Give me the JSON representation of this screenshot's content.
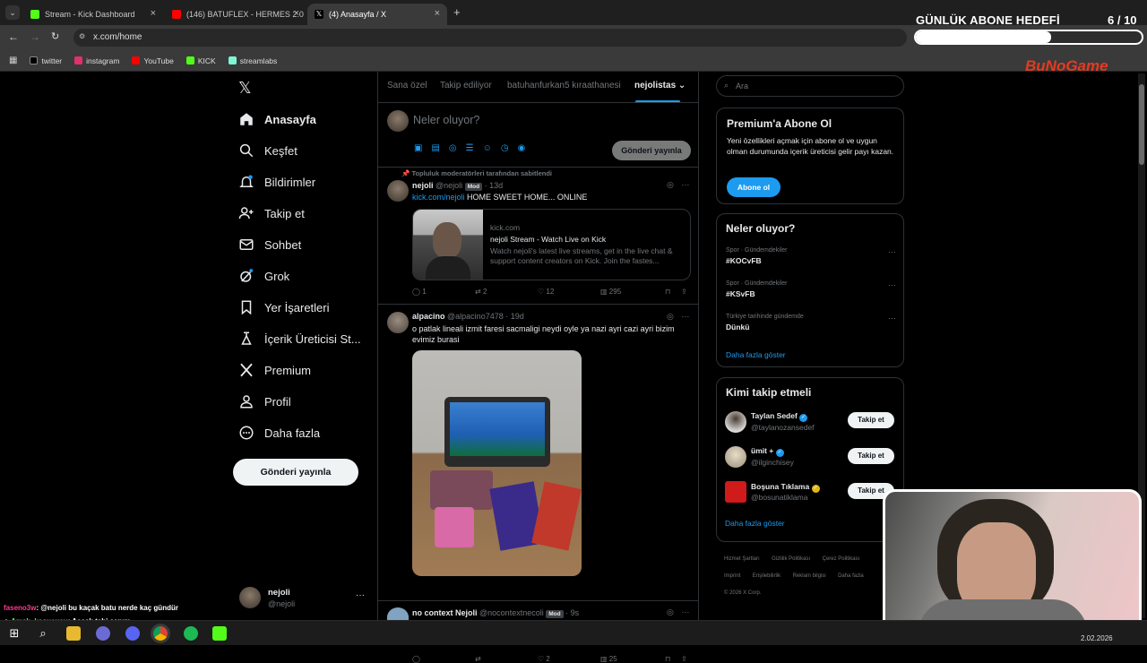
{
  "browser": {
    "tabs": [
      {
        "label": "Stream - Kick Dashboard",
        "color": "#53fc18"
      },
      {
        "label": "(146) BATUFLEX - HERMES 2.0 |",
        "color": "#ff0000"
      },
      {
        "label": "(4) Anasayfa / X",
        "color": "#ffffff"
      }
    ],
    "new_tab": "+",
    "address": "x.com/home",
    "bookmarks": [
      {
        "label": "twitter",
        "color": "#ffffff"
      },
      {
        "label": "instagram",
        "color": "#e1306c"
      },
      {
        "label": "YouTube",
        "color": "#ff0000"
      },
      {
        "label": "KICK",
        "color": "#53fc18"
      },
      {
        "label": "streamlabs",
        "color": "#80f5d2"
      }
    ]
  },
  "overlay": {
    "goal_title": "GÜNLÜK ABONE HEDEFİ",
    "goal_count": "6 / 10",
    "goal_progress": 0.6,
    "brand": "BuNoGame",
    "chat": [
      {
        "user": "faseno3w",
        "text": ": @nejoli bu kaçak batu nerde kaç gündür",
        "color": "#ff3b8d"
      },
      {
        "user": "Amck_kosucusu",
        "text": ": Açcak tabi canım",
        "color": "#53fc18"
      }
    ],
    "date": "2.02.2026"
  },
  "nav": {
    "items": [
      {
        "label": "Anasayfa",
        "icon": "home-icon"
      },
      {
        "label": "Keşfet",
        "icon": "search-icon"
      },
      {
        "label": "Bildirimler",
        "icon": "bell-icon"
      },
      {
        "label": "Takip et",
        "icon": "add-user-icon"
      },
      {
        "label": "Sohbet",
        "icon": "mail-icon"
      },
      {
        "label": "Grok",
        "icon": "grok-icon"
      },
      {
        "label": "Yer İşaretleri",
        "icon": "bookmark-icon"
      },
      {
        "label": "İçerik Üreticisi St...",
        "icon": "creator-icon"
      },
      {
        "label": "Premium",
        "icon": "x-logo-icon"
      },
      {
        "label": "Profil",
        "icon": "profile-icon"
      },
      {
        "label": "Daha fazla",
        "icon": "more-circle-icon"
      }
    ],
    "post_button": "Gönderi yayınla",
    "account": {
      "name": "nejoli",
      "handle": "@nejoli",
      "menu": "···"
    }
  },
  "feed": {
    "tabs": [
      "Sana özel",
      "Takip ediliyor",
      "batuhanfurkan5 kıraathanesi",
      "nejolistas"
    ],
    "active_tab": "nejolistas",
    "composer_placeholder": "Neler oluyor?",
    "composer_button": "Gönderi yayınla",
    "pinned_note": "Topluluk moderatörleri tarafından sabitlendi",
    "posts": [
      {
        "name": "nejoli",
        "handle": "@nejoli",
        "badge": "Mod",
        "time": "· 13d",
        "link_text": "kick.com/nejoli",
        "text": "HOME SWEET HOME... ONLINE",
        "card": {
          "domain": "kick.com",
          "title": "nejoli Stream - Watch Live on Kick",
          "desc": "Watch nejoli's latest live streams, get in the live chat & support content creators on Kick. Join the fastes..."
        },
        "stats": {
          "replies": "1",
          "reposts": "2",
          "likes": "12",
          "views": "295"
        }
      },
      {
        "name": "alpacino",
        "handle": "@alpacino7478",
        "time": "· 19d",
        "text": "o patlak lineali izmit faresi sacmaligi neydi oyle ya nazi ayri cazi ayri bizim evimiz burasi",
        "stats": {
          "replies": "",
          "reposts": "",
          "likes": "2",
          "views": "25"
        }
      },
      {
        "name": "no context Nejoli",
        "handle": "@nocontextnecoli",
        "badge": "Mod",
        "time": "· 9s"
      }
    ]
  },
  "right": {
    "search_placeholder": "Ara",
    "premium": {
      "title": "Premium'a Abone Ol",
      "text": "Yeni özellikleri açmak için abone ol ve uygun olman durumunda içerik üreticisi gelir payı kazan.",
      "button": "Abone ol"
    },
    "trends": {
      "title": "Neler oluyor?",
      "items": [
        {
          "category": "Spor · Gündemdekiler",
          "name": "#KOCvFB"
        },
        {
          "category": "Spor · Gündemdekiler",
          "name": "#KSvFB"
        },
        {
          "category": "Türkiye tarihinde gündemde",
          "name": "Dünkü"
        }
      ],
      "more": "Daha fazla göster"
    },
    "who_to_follow": {
      "title": "Kimi takip etmeli",
      "users": [
        {
          "name": "Taylan Sedef",
          "handle": "@taylanozansedef",
          "button": "Takip et",
          "verified": "#1d9bf0"
        },
        {
          "name": "ümit +",
          "handle": "@ilginchisey",
          "button": "Takip et",
          "verified": "#1d9bf0"
        },
        {
          "name": "Boşuna Tıklama",
          "handle": "@bosunatiklama",
          "button": "Takip et",
          "verified": "#e2b719"
        }
      ],
      "more": "Daha fazla göster"
    },
    "footer": {
      "links": [
        "Hizmet Şartları",
        "Gizlilik Politikası",
        "Çerez Politikası",
        "Imprint",
        "Erişilebilirlik",
        "Reklam bilgisi",
        "Daha fazla"
      ],
      "copyright": "© 2026 X Corp."
    }
  }
}
